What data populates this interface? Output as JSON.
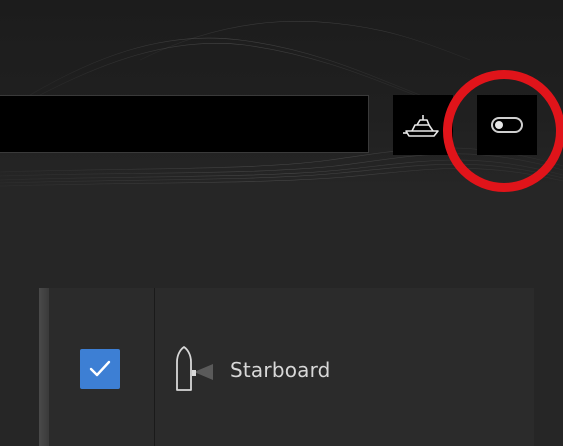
{
  "header": {
    "vessel_name_value": "",
    "vessel_icon": "boat-icon",
    "toggle_icon": "toggle-switch-icon",
    "toggle_state": "off"
  },
  "highlight": {
    "color": "#e0141a",
    "target": "toggle-switch-button"
  },
  "list": {
    "items": [
      {
        "label": "Starboard",
        "checked": true,
        "icon": "bow-starboard-thruster-icon"
      }
    ]
  },
  "colors": {
    "checkbox_accent": "#3d7fd4",
    "background": "#262626",
    "panel": "#2b2b2b"
  }
}
